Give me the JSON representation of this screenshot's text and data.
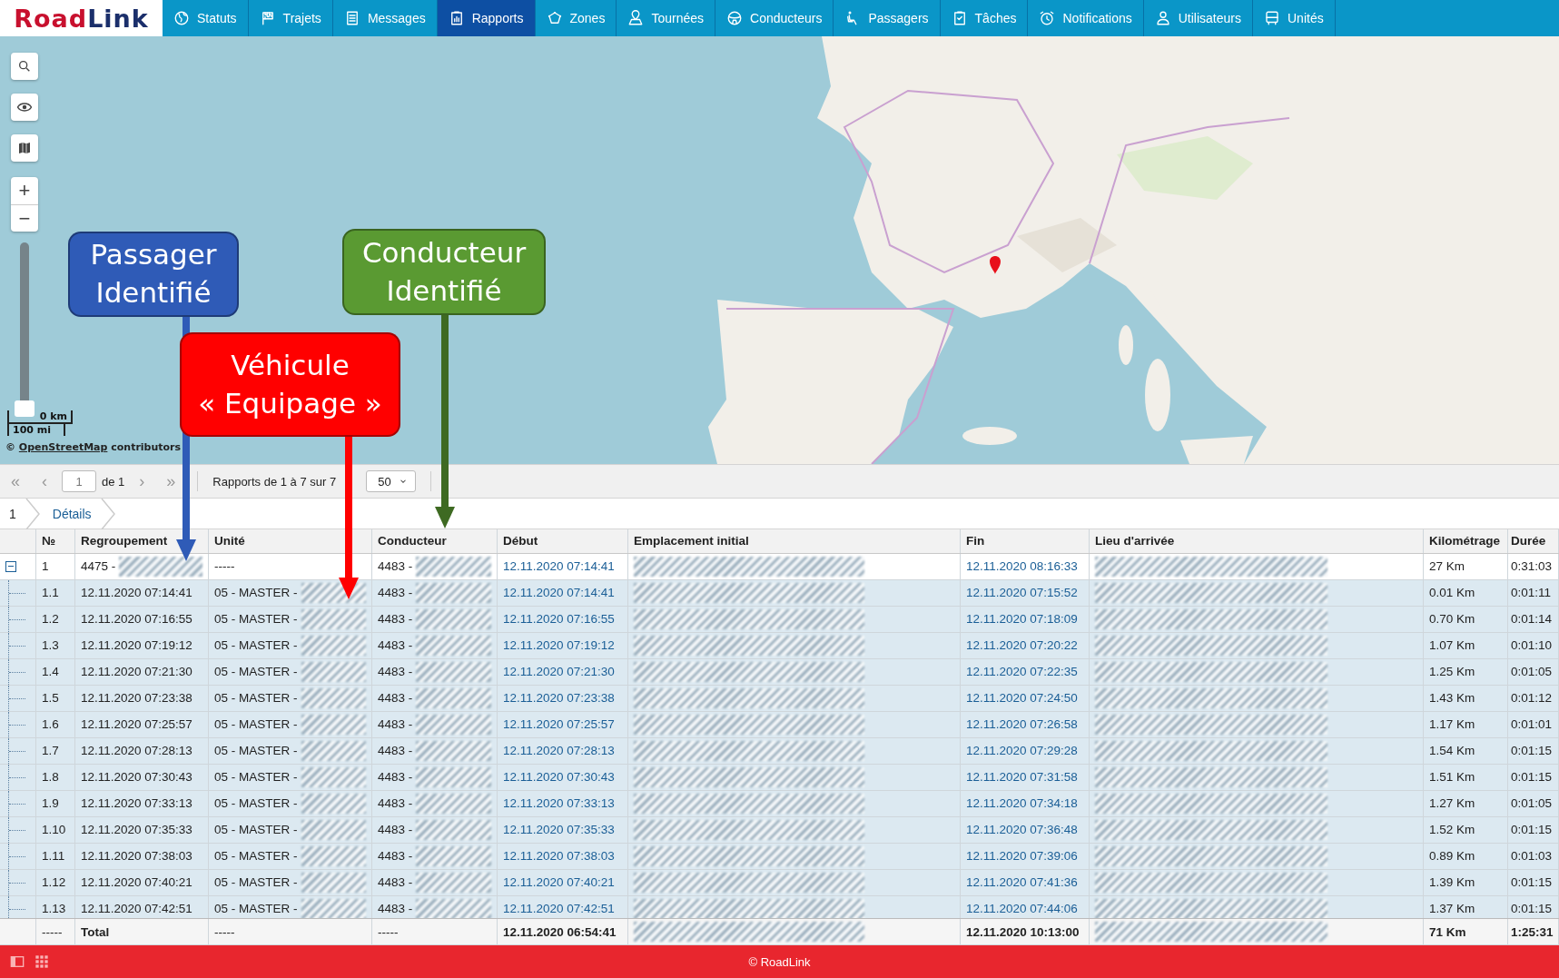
{
  "logo": [
    {
      "text": "Road",
      "color": "#c8102e"
    },
    {
      "text": "Link",
      "color": "#1b2f6b"
    }
  ],
  "nav": [
    {
      "label": "Statuts",
      "selected": false
    },
    {
      "label": "Trajets",
      "selected": false
    },
    {
      "label": "Messages",
      "selected": false
    },
    {
      "label": "Rapports",
      "selected": true
    },
    {
      "label": "Zones",
      "selected": false
    },
    {
      "label": "Tournées",
      "selected": false
    },
    {
      "label": "Conducteurs",
      "selected": false
    },
    {
      "label": "Passagers",
      "selected": false
    },
    {
      "label": "Tâches",
      "selected": false
    },
    {
      "label": "Notifications",
      "selected": false
    },
    {
      "label": "Utilisateurs",
      "selected": false
    },
    {
      "label": "Unités",
      "selected": false
    }
  ],
  "map": {
    "zoom_in": "+",
    "zoom_out": "−",
    "zoom_slider": {
      "level": 0
    },
    "scale": [
      "0 km",
      "100 mi"
    ],
    "attribution": {
      "prefix": "© ",
      "link": "OpenStreetMap",
      "suffix": " contributors"
    }
  },
  "callouts": [
    {
      "lines": [
        "Passager",
        "Identifié"
      ],
      "color": "#2f5bb7"
    },
    {
      "lines": [
        "Conducteur",
        "Identifié"
      ],
      "color": "#5a9a32"
    },
    {
      "lines": [
        "Véhicule",
        "« Equipage »"
      ],
      "color": "#ff0000"
    }
  ],
  "pager": {
    "first": "«",
    "prev": "‹",
    "page": "1",
    "of": "de 1",
    "next": "›",
    "last": "»",
    "info": "Rapports de 1 à 7 sur 7",
    "page_size": "50"
  },
  "breadcrumb": [
    "1",
    "Détails"
  ],
  "table": {
    "columns": [
      "№",
      "Regroupement",
      "Unité",
      "Conducteur",
      "Début",
      "Emplacement initial",
      "Fin",
      "Lieu d'arrivée",
      "Kilométrage",
      "Durée"
    ],
    "rows": [
      {
        "no": "1",
        "grouping": "4475 -",
        "unit": "-----",
        "driver": "4483 -",
        "start": "12.11.2020 07:14:41",
        "end": "12.11.2020 08:16:33",
        "distance": "27 Km",
        "duration": "0:31:03",
        "expanded": true,
        "children": [
          {
            "no": "1.1",
            "grouping": "12.11.2020 07:14:41",
            "unit": "05 - MASTER -",
            "driver": "4483 -",
            "start": "12.11.2020 07:14:41",
            "end": "12.11.2020 07:15:52",
            "distance": "0.01 Km",
            "duration": "0:01:11"
          },
          {
            "no": "1.2",
            "grouping": "12.11.2020 07:16:55",
            "unit": "05 - MASTER -",
            "driver": "4483 -",
            "start": "12.11.2020 07:16:55",
            "end": "12.11.2020 07:18:09",
            "distance": "0.70 Km",
            "duration": "0:01:14"
          },
          {
            "no": "1.3",
            "grouping": "12.11.2020 07:19:12",
            "unit": "05 - MASTER -",
            "driver": "4483 -",
            "start": "12.11.2020 07:19:12",
            "end": "12.11.2020 07:20:22",
            "distance": "1.07 Km",
            "duration": "0:01:10"
          },
          {
            "no": "1.4",
            "grouping": "12.11.2020 07:21:30",
            "unit": "05 - MASTER -",
            "driver": "4483 -",
            "start": "12.11.2020 07:21:30",
            "end": "12.11.2020 07:22:35",
            "distance": "1.25 Km",
            "duration": "0:01:05"
          },
          {
            "no": "1.5",
            "grouping": "12.11.2020 07:23:38",
            "unit": "05 - MASTER -",
            "driver": "4483 -",
            "start": "12.11.2020 07:23:38",
            "end": "12.11.2020 07:24:50",
            "distance": "1.43 Km",
            "duration": "0:01:12"
          },
          {
            "no": "1.6",
            "grouping": "12.11.2020 07:25:57",
            "unit": "05 - MASTER -",
            "driver": "4483 -",
            "start": "12.11.2020 07:25:57",
            "end": "12.11.2020 07:26:58",
            "distance": "1.17 Km",
            "duration": "0:01:01"
          },
          {
            "no": "1.7",
            "grouping": "12.11.2020 07:28:13",
            "unit": "05 - MASTER -",
            "driver": "4483 -",
            "start": "12.11.2020 07:28:13",
            "end": "12.11.2020 07:29:28",
            "distance": "1.54 Km",
            "duration": "0:01:15"
          },
          {
            "no": "1.8",
            "grouping": "12.11.2020 07:30:43",
            "unit": "05 - MASTER -",
            "driver": "4483 -",
            "start": "12.11.2020 07:30:43",
            "end": "12.11.2020 07:31:58",
            "distance": "1.51 Km",
            "duration": "0:01:15"
          },
          {
            "no": "1.9",
            "grouping": "12.11.2020 07:33:13",
            "unit": "05 - MASTER -",
            "driver": "4483 -",
            "start": "12.11.2020 07:33:13",
            "end": "12.11.2020 07:34:18",
            "distance": "1.27 Km",
            "duration": "0:01:05"
          },
          {
            "no": "1.10",
            "grouping": "12.11.2020 07:35:33",
            "unit": "05 - MASTER -",
            "driver": "4483 -",
            "start": "12.11.2020 07:35:33",
            "end": "12.11.2020 07:36:48",
            "distance": "1.52 Km",
            "duration": "0:01:15"
          },
          {
            "no": "1.11",
            "grouping": "12.11.2020 07:38:03",
            "unit": "05 - MASTER -",
            "driver": "4483 -",
            "start": "12.11.2020 07:38:03",
            "end": "12.11.2020 07:39:06",
            "distance": "0.89 Km",
            "duration": "0:01:03"
          },
          {
            "no": "1.12",
            "grouping": "12.11.2020 07:40:21",
            "unit": "05 - MASTER -",
            "driver": "4483 -",
            "start": "12.11.2020 07:40:21",
            "end": "12.11.2020 07:41:36",
            "distance": "1.39 Km",
            "duration": "0:01:15"
          },
          {
            "no": "1.13",
            "grouping": "12.11.2020 07:42:51",
            "unit": "05 - MASTER -",
            "driver": "4483 -",
            "start": "12.11.2020 07:42:51",
            "end": "12.11.2020 07:44:06",
            "distance": "1.37 Km",
            "duration": "0:01:15"
          }
        ]
      }
    ],
    "total": {
      "no": "-----",
      "grouping": "Total",
      "unit": "-----",
      "driver": "-----",
      "start": "12.11.2020 06:54:41",
      "end": "12.11.2020 10:13:00",
      "distance": "71 Km",
      "duration": "1:25:31"
    }
  },
  "footer": {
    "text": "© RoadLink"
  }
}
